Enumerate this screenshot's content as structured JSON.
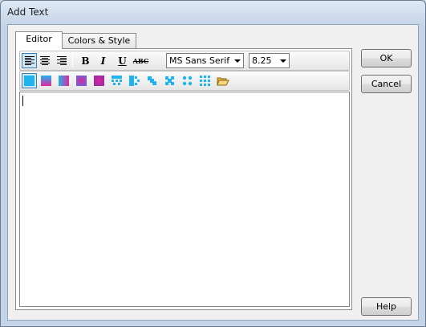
{
  "window": {
    "title": "Add Text"
  },
  "tabs": [
    {
      "label": "Editor",
      "active": true
    },
    {
      "label": "Colors & Style",
      "active": false
    }
  ],
  "toolbar": {
    "align_left_icon": "align-left-icon",
    "align_center_icon": "align-center-icon",
    "align_right_icon": "align-right-icon",
    "bold_label": "B",
    "italic_label": "I",
    "underline_label": "U",
    "strikethrough_label": "ABC",
    "font_name": "MS Sans Serif",
    "font_size": "8.25"
  },
  "fill_toolbar": {
    "icons": [
      "solid-fill-icon",
      "gradient-horizontal-icon",
      "gradient-vertical-icon",
      "gradient-center-icon",
      "gradient-radial-icon",
      "pattern-checker-icon",
      "pattern-blocks-icon",
      "pattern-cross-icon",
      "pattern-diamond-icon",
      "pattern-dots-icon",
      "pattern-grid-icon",
      "open-folder-icon"
    ],
    "accent_cyan": "#1fb4f0",
    "accent_magenta": "#e0259e"
  },
  "editor": {
    "text": ""
  },
  "buttons": {
    "ok": "OK",
    "cancel": "Cancel",
    "help": "Help"
  }
}
